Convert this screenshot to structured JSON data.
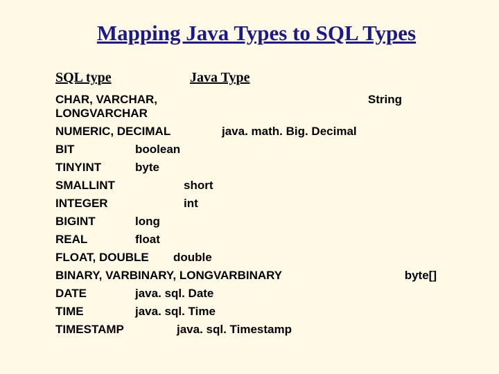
{
  "title": "Mapping Java Types to SQL Types",
  "headers": {
    "sql": "SQL type",
    "java": "Java Type"
  },
  "rows": [
    {
      "sql": "CHAR, VARCHAR, LONGVARCHAR",
      "java": "String"
    },
    {
      "sql": "NUMERIC, DECIMAL",
      "java": "java. math. Big. Decimal"
    },
    {
      "sql": "BIT",
      "java": "boolean"
    },
    {
      "sql": "TINYINT",
      "java": "byte"
    },
    {
      "sql": "SMALLINT",
      "java": "short"
    },
    {
      "sql": "INTEGER",
      "java": "int"
    },
    {
      "sql": "BIGINT",
      "java": "long"
    },
    {
      "sql": "REAL",
      "java": "float"
    },
    {
      "sql": "FLOAT, DOUBLE",
      "java": "double"
    },
    {
      "sql": "BINARY, VARBINARY, LONGVARBINARY",
      "java": "byte[]"
    },
    {
      "sql": "DATE",
      "java": "java. sql. Date"
    },
    {
      "sql": "TIME",
      "java": "java. sql. Time"
    },
    {
      "sql": "TIMESTAMP",
      "java": "java. sql. Timestamp"
    }
  ],
  "chart_data": {
    "type": "table",
    "title": "Mapping Java Types to SQL Types",
    "columns": [
      "SQL type",
      "Java Type"
    ],
    "rows": [
      [
        "CHAR, VARCHAR, LONGVARCHAR",
        "String"
      ],
      [
        "NUMERIC, DECIMAL",
        "java.math.BigDecimal"
      ],
      [
        "BIT",
        "boolean"
      ],
      [
        "TINYINT",
        "byte"
      ],
      [
        "SMALLINT",
        "short"
      ],
      [
        "INTEGER",
        "int"
      ],
      [
        "BIGINT",
        "long"
      ],
      [
        "REAL",
        "float"
      ],
      [
        "FLOAT, DOUBLE",
        "double"
      ],
      [
        "BINARY, VARBINARY, LONGVARBINARY",
        "byte[]"
      ],
      [
        "DATE",
        "java.sql.Date"
      ],
      [
        "TIME",
        "java.sql.Time"
      ],
      [
        "TIMESTAMP",
        "java.sql.Timestamp"
      ]
    ]
  }
}
